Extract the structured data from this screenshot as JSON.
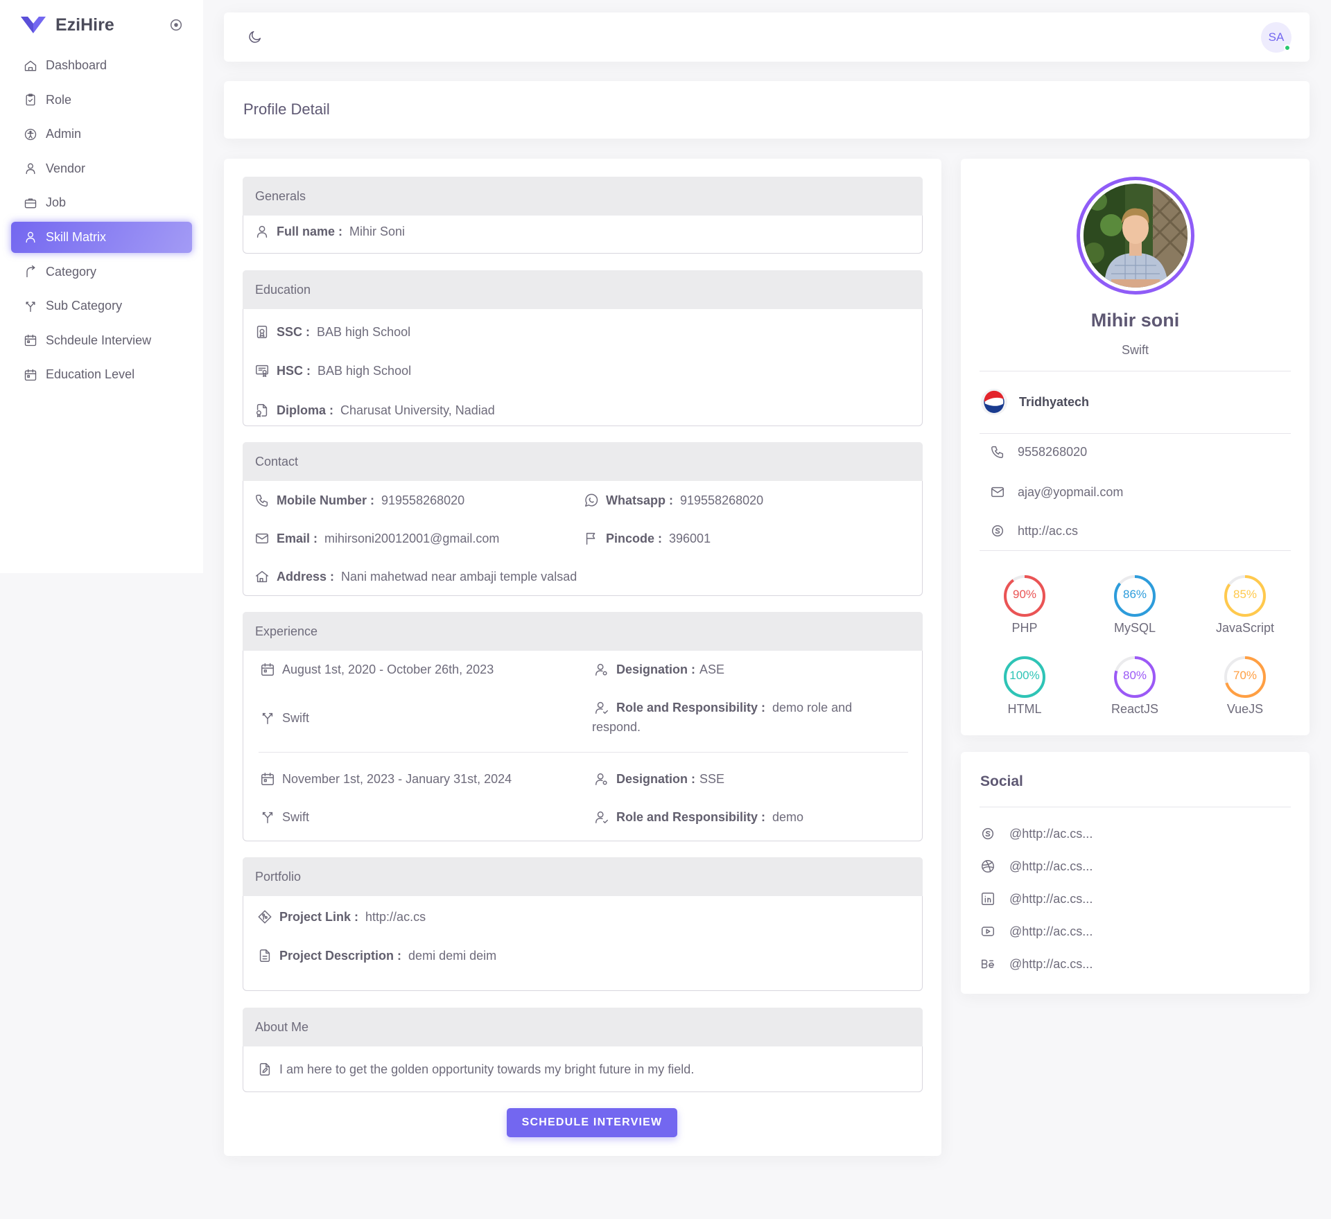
{
  "brand": {
    "name": "EziHire"
  },
  "sidebar": {
    "items": [
      {
        "label": "Dashboard",
        "icon": "home-icon"
      },
      {
        "label": "Role",
        "icon": "clipboard-icon"
      },
      {
        "label": "Admin",
        "icon": "accessibility-icon"
      },
      {
        "label": "Vendor",
        "icon": "user-icon"
      },
      {
        "label": "Job",
        "icon": "briefcase-icon"
      },
      {
        "label": "Skill Matrix",
        "icon": "user-icon",
        "active": true
      },
      {
        "label": "Category",
        "icon": "arrow-up-right-icon"
      },
      {
        "label": "Sub Category",
        "icon": "split-arrow-icon"
      },
      {
        "label": "Schdeule Interview",
        "icon": "calendar-icon"
      },
      {
        "label": "Education Level",
        "icon": "calendar-icon"
      }
    ]
  },
  "header": {
    "avatar_initials": "SA"
  },
  "page": {
    "title": "Profile Detail"
  },
  "generals": {
    "heading": "Generals",
    "full_name_label": "Full name :",
    "full_name": "Mihir Soni"
  },
  "education": {
    "heading": "Education",
    "ssc_label": "SSC :",
    "ssc": "BAB high School",
    "hsc_label": "HSC :",
    "hsc": "BAB high School",
    "diploma_label": "Diploma :",
    "diploma": "Charusat University, Nadiad"
  },
  "contact": {
    "heading": "Contact",
    "mobile_label": "Mobile Number :",
    "mobile": "919558268020",
    "whatsapp_label": "Whatsapp :",
    "whatsapp": "919558268020",
    "email_label": "Email :",
    "email": "mihirsoni20012001@gmail.com",
    "pincode_label": "Pincode :",
    "pincode": "396001",
    "address_label": "Address :",
    "address": "Nani mahetwad near ambaji temple valsad"
  },
  "experience": {
    "heading": "Experience",
    "designation_label": "Designation :",
    "role_label": "Role and Responsibility :",
    "items": [
      {
        "dates": "August 1st, 2020 - October 26th, 2023",
        "designation": "ASE",
        "skill": "Swift",
        "role_line1": "demo role and",
        "role_line2": "respond."
      },
      {
        "dates": "November 1st, 2023 - January 31st, 2024",
        "designation": "SSE",
        "skill": "Swift",
        "role_line1": "demo"
      }
    ]
  },
  "portfolio": {
    "heading": "Portfolio",
    "link_label": "Project Link :",
    "link": "http://ac.cs",
    "desc_label": "Project Description :",
    "desc": "demi demi deim"
  },
  "about": {
    "heading": "About Me",
    "text": "I am here to get the golden opportunity towards my bright future in my field."
  },
  "actions": {
    "schedule_label": "SCHEDULE INTERVIEW"
  },
  "profile": {
    "name": "Mihir soni",
    "role": "Swift",
    "company": "Tridhyatech",
    "phone": "9558268020",
    "email": "ajay@yopmail.com",
    "skype": "http://ac.cs",
    "skills": [
      {
        "name": "PHP",
        "percent": 90,
        "label": "90%",
        "color": "#ea5455"
      },
      {
        "name": "MySQL",
        "percent": 86,
        "label": "86%",
        "color": "#2d9cdb"
      },
      {
        "name": "JavaScript",
        "percent": 85,
        "label": "85%",
        "color": "#ffc94d"
      },
      {
        "name": "HTML",
        "percent": 100,
        "label": "100%",
        "color": "#2ec4b6"
      },
      {
        "name": "ReactJS",
        "percent": 80,
        "label": "80%",
        "color": "#9b59f6"
      },
      {
        "name": "VueJS",
        "percent": 70,
        "label": "70%",
        "color": "#ff9f43"
      }
    ]
  },
  "social": {
    "heading": "Social",
    "items": [
      {
        "icon": "skype-icon",
        "handle": "@http://ac.cs..."
      },
      {
        "icon": "dribbble-icon",
        "handle": "@http://ac.cs..."
      },
      {
        "icon": "linkedin-icon",
        "handle": "@http://ac.cs..."
      },
      {
        "icon": "youtube-icon",
        "handle": "@http://ac.cs..."
      },
      {
        "icon": "behance-icon",
        "handle": "@http://ac.cs..."
      }
    ]
  },
  "colors": {
    "primary": "#7367f0",
    "online": "#28c76f",
    "photo_ring": "#8f5cf7"
  }
}
